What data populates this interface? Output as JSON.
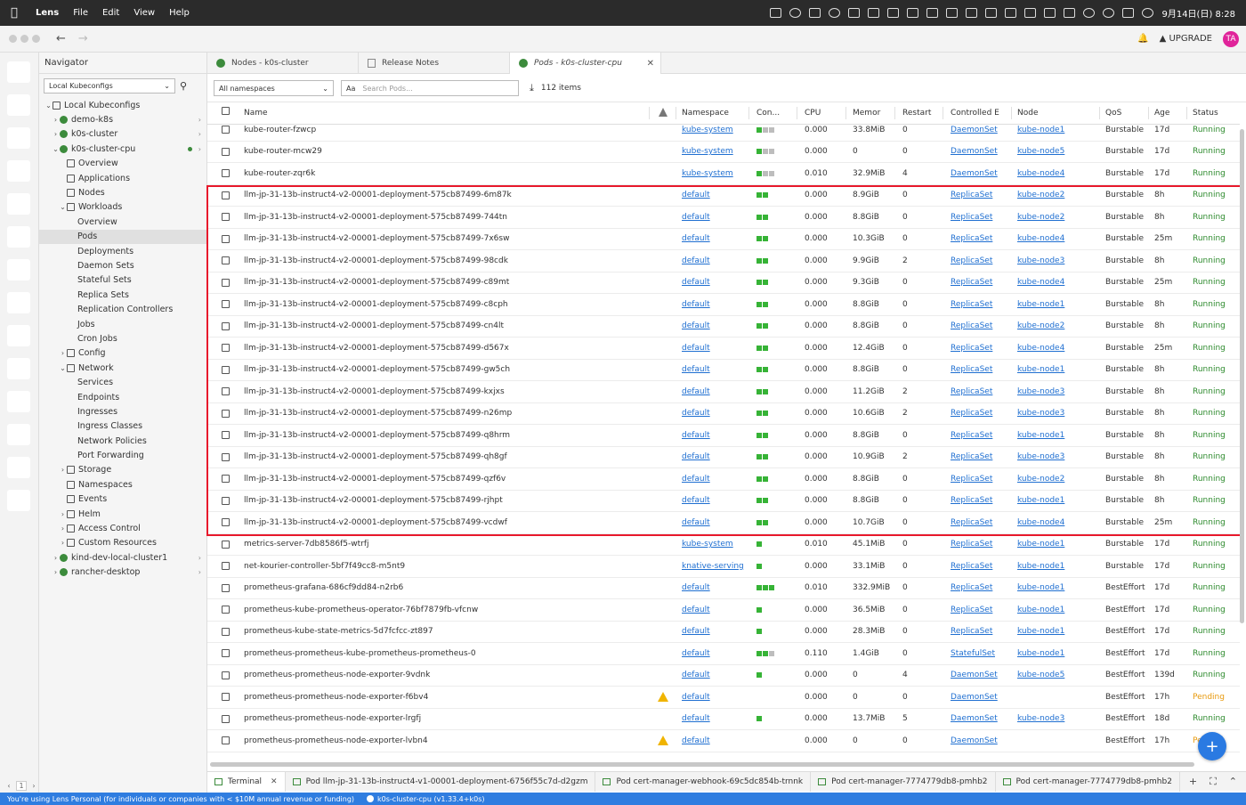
{
  "menubar": {
    "app": "Lens",
    "menus": [
      "File",
      "Edit",
      "View",
      "Help"
    ],
    "clock": "9月14日(日) 8:28"
  },
  "titlebar": {
    "upgrade": "UPGRADE",
    "avatar": "TA"
  },
  "hotbar": {
    "page": "1"
  },
  "navigator": {
    "title": "Navigator",
    "context_select": "Local Kubeconfigs",
    "tree": [
      {
        "label": "Local Kubeconfigs",
        "level": 0,
        "chev": "⌄",
        "icon": "folder"
      },
      {
        "label": "demo-k8s",
        "level": 1,
        "chev": "›",
        "icon": "cluster",
        "trail": "›"
      },
      {
        "label": "k0s-cluster",
        "level": 1,
        "chev": "›",
        "icon": "cluster",
        "trail": "›"
      },
      {
        "label": "k0s-cluster-cpu",
        "level": 1,
        "chev": "⌄",
        "icon": "cluster",
        "trail": "›",
        "dot": true
      },
      {
        "label": "Overview",
        "level": 2,
        "chev": "",
        "icon": "grid"
      },
      {
        "label": "Applications",
        "level": 2,
        "chev": "",
        "icon": "grid"
      },
      {
        "label": "Nodes",
        "level": 2,
        "chev": "",
        "icon": "grid"
      },
      {
        "label": "Workloads",
        "level": 2,
        "chev": "⌄",
        "icon": "grid"
      },
      {
        "label": "Overview",
        "level": 3,
        "chev": ""
      },
      {
        "label": "Pods",
        "level": 3,
        "chev": "",
        "active": true
      },
      {
        "label": "Deployments",
        "level": 3,
        "chev": ""
      },
      {
        "label": "Daemon Sets",
        "level": 3,
        "chev": ""
      },
      {
        "label": "Stateful Sets",
        "level": 3,
        "chev": ""
      },
      {
        "label": "Replica Sets",
        "level": 3,
        "chev": ""
      },
      {
        "label": "Replication Controllers",
        "level": 3,
        "chev": ""
      },
      {
        "label": "Jobs",
        "level": 3,
        "chev": ""
      },
      {
        "label": "Cron Jobs",
        "level": 3,
        "chev": ""
      },
      {
        "label": "Config",
        "level": 2,
        "chev": "›",
        "icon": "grid"
      },
      {
        "label": "Network",
        "level": 2,
        "chev": "⌄",
        "icon": "grid"
      },
      {
        "label": "Services",
        "level": 3,
        "chev": ""
      },
      {
        "label": "Endpoints",
        "level": 3,
        "chev": ""
      },
      {
        "label": "Ingresses",
        "level": 3,
        "chev": ""
      },
      {
        "label": "Ingress Classes",
        "level": 3,
        "chev": ""
      },
      {
        "label": "Network Policies",
        "level": 3,
        "chev": ""
      },
      {
        "label": "Port Forwarding",
        "level": 3,
        "chev": ""
      },
      {
        "label": "Storage",
        "level": 2,
        "chev": "›",
        "icon": "grid"
      },
      {
        "label": "Namespaces",
        "level": 2,
        "chev": "",
        "icon": "grid"
      },
      {
        "label": "Events",
        "level": 2,
        "chev": "",
        "icon": "grid"
      },
      {
        "label": "Helm",
        "level": 2,
        "chev": "›",
        "icon": "grid"
      },
      {
        "label": "Access Control",
        "level": 2,
        "chev": "›",
        "icon": "grid"
      },
      {
        "label": "Custom Resources",
        "level": 2,
        "chev": "›",
        "icon": "grid"
      },
      {
        "label": "kind-dev-local-cluster1",
        "level": 1,
        "chev": "›",
        "icon": "cluster",
        "trail": "›"
      },
      {
        "label": "rancher-desktop",
        "level": 1,
        "chev": "›",
        "icon": "cluster",
        "trail": "›"
      }
    ]
  },
  "tabs": [
    {
      "label": "Nodes - k0s-cluster",
      "icon": "k8s"
    },
    {
      "label": "Release Notes",
      "icon": "doc"
    },
    {
      "label": "Pods - k0s-cluster-cpu",
      "icon": "k8s",
      "active": true
    }
  ],
  "filter": {
    "namespace": "All namespaces",
    "search_placeholder": "Search Pods...",
    "case_toggle": "Aa",
    "count": "112 items"
  },
  "columns": [
    "Name",
    "Namespace",
    "Con...",
    "CPU",
    "Memor",
    "Restart",
    "Controlled E",
    "Node",
    "QoS",
    "Age",
    "Status"
  ],
  "pods": [
    {
      "name": "kube-router-fzwcp",
      "ns": "kube-system",
      "con": "gxx",
      "cpu": "0.000",
      "mem": "33.8MiB",
      "rst": "0",
      "ctl": "DaemonSet",
      "node": "kube-node1",
      "qos": "Burstable",
      "age": "17d",
      "status": "Running"
    },
    {
      "name": "kube-router-mcw29",
      "ns": "kube-system",
      "con": "gxx",
      "cpu": "0.000",
      "mem": "0",
      "rst": "0",
      "ctl": "DaemonSet",
      "node": "kube-node5",
      "qos": "Burstable",
      "age": "17d",
      "status": "Running"
    },
    {
      "name": "kube-router-zqr6k",
      "ns": "kube-system",
      "con": "gxx",
      "cpu": "0.010",
      "mem": "32.9MiB",
      "rst": "4",
      "ctl": "DaemonSet",
      "node": "kube-node4",
      "qos": "Burstable",
      "age": "17d",
      "status": "Running"
    },
    {
      "name": "llm-jp-31-13b-instruct4-v2-00001-deployment-575cb87499-6m87k",
      "ns": "default",
      "con": "gg",
      "cpu": "0.000",
      "mem": "8.9GiB",
      "rst": "0",
      "ctl": "ReplicaSet",
      "node": "kube-node2",
      "qos": "Burstable",
      "age": "8h",
      "status": "Running"
    },
    {
      "name": "llm-jp-31-13b-instruct4-v2-00001-deployment-575cb87499-744tn",
      "ns": "default",
      "con": "gg",
      "cpu": "0.000",
      "mem": "8.8GiB",
      "rst": "0",
      "ctl": "ReplicaSet",
      "node": "kube-node2",
      "qos": "Burstable",
      "age": "8h",
      "status": "Running"
    },
    {
      "name": "llm-jp-31-13b-instruct4-v2-00001-deployment-575cb87499-7x6sw",
      "ns": "default",
      "con": "gg",
      "cpu": "0.000",
      "mem": "10.3GiB",
      "rst": "0",
      "ctl": "ReplicaSet",
      "node": "kube-node4",
      "qos": "Burstable",
      "age": "25m",
      "status": "Running"
    },
    {
      "name": "llm-jp-31-13b-instruct4-v2-00001-deployment-575cb87499-98cdk",
      "ns": "default",
      "con": "gg",
      "cpu": "0.000",
      "mem": "9.9GiB",
      "rst": "2",
      "ctl": "ReplicaSet",
      "node": "kube-node3",
      "qos": "Burstable",
      "age": "8h",
      "status": "Running"
    },
    {
      "name": "llm-jp-31-13b-instruct4-v2-00001-deployment-575cb87499-c89mt",
      "ns": "default",
      "con": "gg",
      "cpu": "0.000",
      "mem": "9.3GiB",
      "rst": "0",
      "ctl": "ReplicaSet",
      "node": "kube-node4",
      "qos": "Burstable",
      "age": "25m",
      "status": "Running"
    },
    {
      "name": "llm-jp-31-13b-instruct4-v2-00001-deployment-575cb87499-c8cph",
      "ns": "default",
      "con": "gg",
      "cpu": "0.000",
      "mem": "8.8GiB",
      "rst": "0",
      "ctl": "ReplicaSet",
      "node": "kube-node1",
      "qos": "Burstable",
      "age": "8h",
      "status": "Running"
    },
    {
      "name": "llm-jp-31-13b-instruct4-v2-00001-deployment-575cb87499-cn4lt",
      "ns": "default",
      "con": "gg",
      "cpu": "0.000",
      "mem": "8.8GiB",
      "rst": "0",
      "ctl": "ReplicaSet",
      "node": "kube-node2",
      "qos": "Burstable",
      "age": "8h",
      "status": "Running"
    },
    {
      "name": "llm-jp-31-13b-instruct4-v2-00001-deployment-575cb87499-d567x",
      "ns": "default",
      "con": "gg",
      "cpu": "0.000",
      "mem": "12.4GiB",
      "rst": "0",
      "ctl": "ReplicaSet",
      "node": "kube-node4",
      "qos": "Burstable",
      "age": "25m",
      "status": "Running"
    },
    {
      "name": "llm-jp-31-13b-instruct4-v2-00001-deployment-575cb87499-gw5ch",
      "ns": "default",
      "con": "gg",
      "cpu": "0.000",
      "mem": "8.8GiB",
      "rst": "0",
      "ctl": "ReplicaSet",
      "node": "kube-node1",
      "qos": "Burstable",
      "age": "8h",
      "status": "Running"
    },
    {
      "name": "llm-jp-31-13b-instruct4-v2-00001-deployment-575cb87499-kxjxs",
      "ns": "default",
      "con": "gg",
      "cpu": "0.000",
      "mem": "11.2GiB",
      "rst": "2",
      "ctl": "ReplicaSet",
      "node": "kube-node3",
      "qos": "Burstable",
      "age": "8h",
      "status": "Running"
    },
    {
      "name": "llm-jp-31-13b-instruct4-v2-00001-deployment-575cb87499-n26mp",
      "ns": "default",
      "con": "gg",
      "cpu": "0.000",
      "mem": "10.6GiB",
      "rst": "2",
      "ctl": "ReplicaSet",
      "node": "kube-node3",
      "qos": "Burstable",
      "age": "8h",
      "status": "Running"
    },
    {
      "name": "llm-jp-31-13b-instruct4-v2-00001-deployment-575cb87499-q8hrm",
      "ns": "default",
      "con": "gg",
      "cpu": "0.000",
      "mem": "8.8GiB",
      "rst": "0",
      "ctl": "ReplicaSet",
      "node": "kube-node1",
      "qos": "Burstable",
      "age": "8h",
      "status": "Running"
    },
    {
      "name": "llm-jp-31-13b-instruct4-v2-00001-deployment-575cb87499-qh8gf",
      "ns": "default",
      "con": "gg",
      "cpu": "0.000",
      "mem": "10.9GiB",
      "rst": "2",
      "ctl": "ReplicaSet",
      "node": "kube-node3",
      "qos": "Burstable",
      "age": "8h",
      "status": "Running"
    },
    {
      "name": "llm-jp-31-13b-instruct4-v2-00001-deployment-575cb87499-qzf6v",
      "ns": "default",
      "con": "gg",
      "cpu": "0.000",
      "mem": "8.8GiB",
      "rst": "0",
      "ctl": "ReplicaSet",
      "node": "kube-node2",
      "qos": "Burstable",
      "age": "8h",
      "status": "Running"
    },
    {
      "name": "llm-jp-31-13b-instruct4-v2-00001-deployment-575cb87499-rjhpt",
      "ns": "default",
      "con": "gg",
      "cpu": "0.000",
      "mem": "8.8GiB",
      "rst": "0",
      "ctl": "ReplicaSet",
      "node": "kube-node1",
      "qos": "Burstable",
      "age": "8h",
      "status": "Running"
    },
    {
      "name": "llm-jp-31-13b-instruct4-v2-00001-deployment-575cb87499-vcdwf",
      "ns": "default",
      "con": "gg",
      "cpu": "0.000",
      "mem": "10.7GiB",
      "rst": "0",
      "ctl": "ReplicaSet",
      "node": "kube-node4",
      "qos": "Burstable",
      "age": "25m",
      "status": "Running"
    },
    {
      "name": "metrics-server-7db8586f5-wtrfj",
      "ns": "kube-system",
      "con": "g",
      "cpu": "0.010",
      "mem": "45.1MiB",
      "rst": "0",
      "ctl": "ReplicaSet",
      "node": "kube-node1",
      "qos": "Burstable",
      "age": "17d",
      "status": "Running"
    },
    {
      "name": "net-kourier-controller-5bf7f49cc8-m5nt9",
      "ns": "knative-serving",
      "con": "g",
      "cpu": "0.000",
      "mem": "33.1MiB",
      "rst": "0",
      "ctl": "ReplicaSet",
      "node": "kube-node1",
      "qos": "Burstable",
      "age": "17d",
      "status": "Running"
    },
    {
      "name": "prometheus-grafana-686cf9dd84-n2rb6",
      "ns": "default",
      "con": "ggg",
      "cpu": "0.010",
      "mem": "332.9MiB",
      "rst": "0",
      "ctl": "ReplicaSet",
      "node": "kube-node1",
      "qos": "BestEffort",
      "age": "17d",
      "status": "Running"
    },
    {
      "name": "prometheus-kube-prometheus-operator-76bf7879fb-vfcnw",
      "ns": "default",
      "con": "g",
      "cpu": "0.000",
      "mem": "36.5MiB",
      "rst": "0",
      "ctl": "ReplicaSet",
      "node": "kube-node1",
      "qos": "BestEffort",
      "age": "17d",
      "status": "Running"
    },
    {
      "name": "prometheus-kube-state-metrics-5d7fcfcc-zt897",
      "ns": "default",
      "con": "g",
      "cpu": "0.000",
      "mem": "28.3MiB",
      "rst": "0",
      "ctl": "ReplicaSet",
      "node": "kube-node1",
      "qos": "BestEffort",
      "age": "17d",
      "status": "Running"
    },
    {
      "name": "prometheus-prometheus-kube-prometheus-prometheus-0",
      "ns": "default",
      "con": "ggx",
      "cpu": "0.110",
      "mem": "1.4GiB",
      "rst": "0",
      "ctl": "StatefulSet",
      "node": "kube-node1",
      "qos": "BestEffort",
      "age": "17d",
      "status": "Running"
    },
    {
      "name": "prometheus-prometheus-node-exporter-9vdnk",
      "ns": "default",
      "con": "g",
      "cpu": "0.000",
      "mem": "0",
      "rst": "4",
      "ctl": "DaemonSet",
      "node": "kube-node5",
      "qos": "BestEffort",
      "age": "139d",
      "status": "Running"
    },
    {
      "name": "prometheus-prometheus-node-exporter-f6bv4",
      "ns": "default",
      "con": "",
      "cpu": "0.000",
      "mem": "0",
      "rst": "0",
      "ctl": "DaemonSet",
      "node": "",
      "qos": "BestEffort",
      "age": "17h",
      "status": "Pending",
      "warn": true
    },
    {
      "name": "prometheus-prometheus-node-exporter-lrgfj",
      "ns": "default",
      "con": "g",
      "cpu": "0.000",
      "mem": "13.7MiB",
      "rst": "5",
      "ctl": "DaemonSet",
      "node": "kube-node3",
      "qos": "BestEffort",
      "age": "18d",
      "status": "Running"
    },
    {
      "name": "prometheus-prometheus-node-exporter-lvbn4",
      "ns": "default",
      "con": "",
      "cpu": "0.000",
      "mem": "0",
      "rst": "0",
      "ctl": "DaemonSet",
      "node": "",
      "qos": "BestEffort",
      "age": "17h",
      "status": "Pending",
      "warn": true
    }
  ],
  "dock": {
    "tabs": [
      {
        "label": "Terminal",
        "active": true
      },
      {
        "label": "Pod llm-jp-31-13b-instruct4-v1-00001-deployment-6756f55c7d-d2gzm"
      },
      {
        "label": "Pod cert-manager-webhook-69c5dc854b-trnnk"
      },
      {
        "label": "Pod cert-manager-7774779db8-pmhb2"
      },
      {
        "label": "Pod cert-manager-7774779db8-pmhb2"
      }
    ]
  },
  "statusbar": {
    "license": "You're using Lens Personal (for individuals or companies with < $10M annual revenue or funding)",
    "cluster": "k0s-cluster-cpu (v1.33.4+k0s)"
  },
  "colors": {
    "accent": "#2a7ae2",
    "running": "#2e8b2e",
    "pending": "#e8990c",
    "highlight": "#e8192c",
    "statusbar": "#2f7de0"
  }
}
